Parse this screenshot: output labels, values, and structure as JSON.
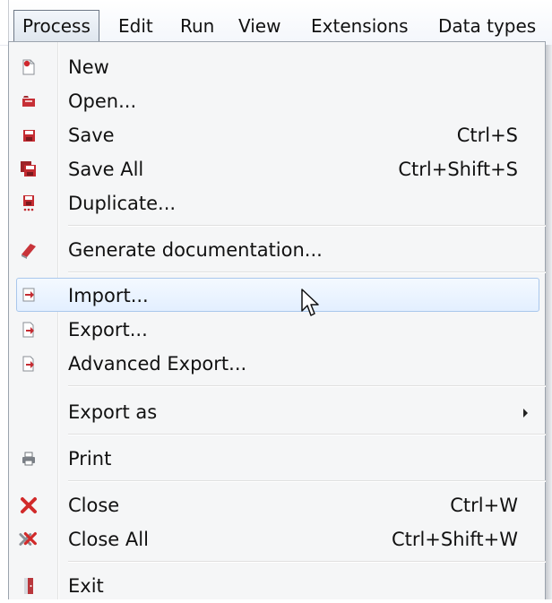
{
  "menubar": {
    "items": [
      "Process",
      "Edit",
      "Run",
      "View",
      "Extensions",
      "Data types"
    ],
    "active": "Process"
  },
  "menu": {
    "new": {
      "label": "New",
      "icon": "new-file-icon"
    },
    "open": {
      "label": "Open...",
      "icon": "open-folder-icon"
    },
    "save": {
      "label": "Save",
      "shortcut": "Ctrl+S",
      "icon": "save-icon"
    },
    "save_all": {
      "label": "Save All",
      "shortcut": "Ctrl+Shift+S",
      "icon": "save-all-icon"
    },
    "duplicate": {
      "label": "Duplicate...",
      "icon": "duplicate-icon"
    },
    "generate_doc": {
      "label": "Generate documentation...",
      "icon": "book-icon"
    },
    "import": {
      "label": "Import...",
      "icon": "import-icon",
      "highlighted": true
    },
    "export": {
      "label": "Export...",
      "icon": "export-icon"
    },
    "advanced_export": {
      "label": "Advanced Export...",
      "icon": "export-icon"
    },
    "export_as": {
      "label": "Export as",
      "submenu": true
    },
    "print": {
      "label": "Print",
      "icon": "printer-icon"
    },
    "close": {
      "label": "Close",
      "shortcut": "Ctrl+W",
      "icon": "close-icon"
    },
    "close_all": {
      "label": "Close All",
      "shortcut": "Ctrl+Shift+W",
      "icon": "close-all-icon"
    },
    "exit": {
      "label": "Exit",
      "icon": "exit-door-icon"
    }
  },
  "colors": {
    "menu_bg": "#f5f6f7",
    "hover_border": "#a9c7ec",
    "icon_red": "#c0272d"
  }
}
